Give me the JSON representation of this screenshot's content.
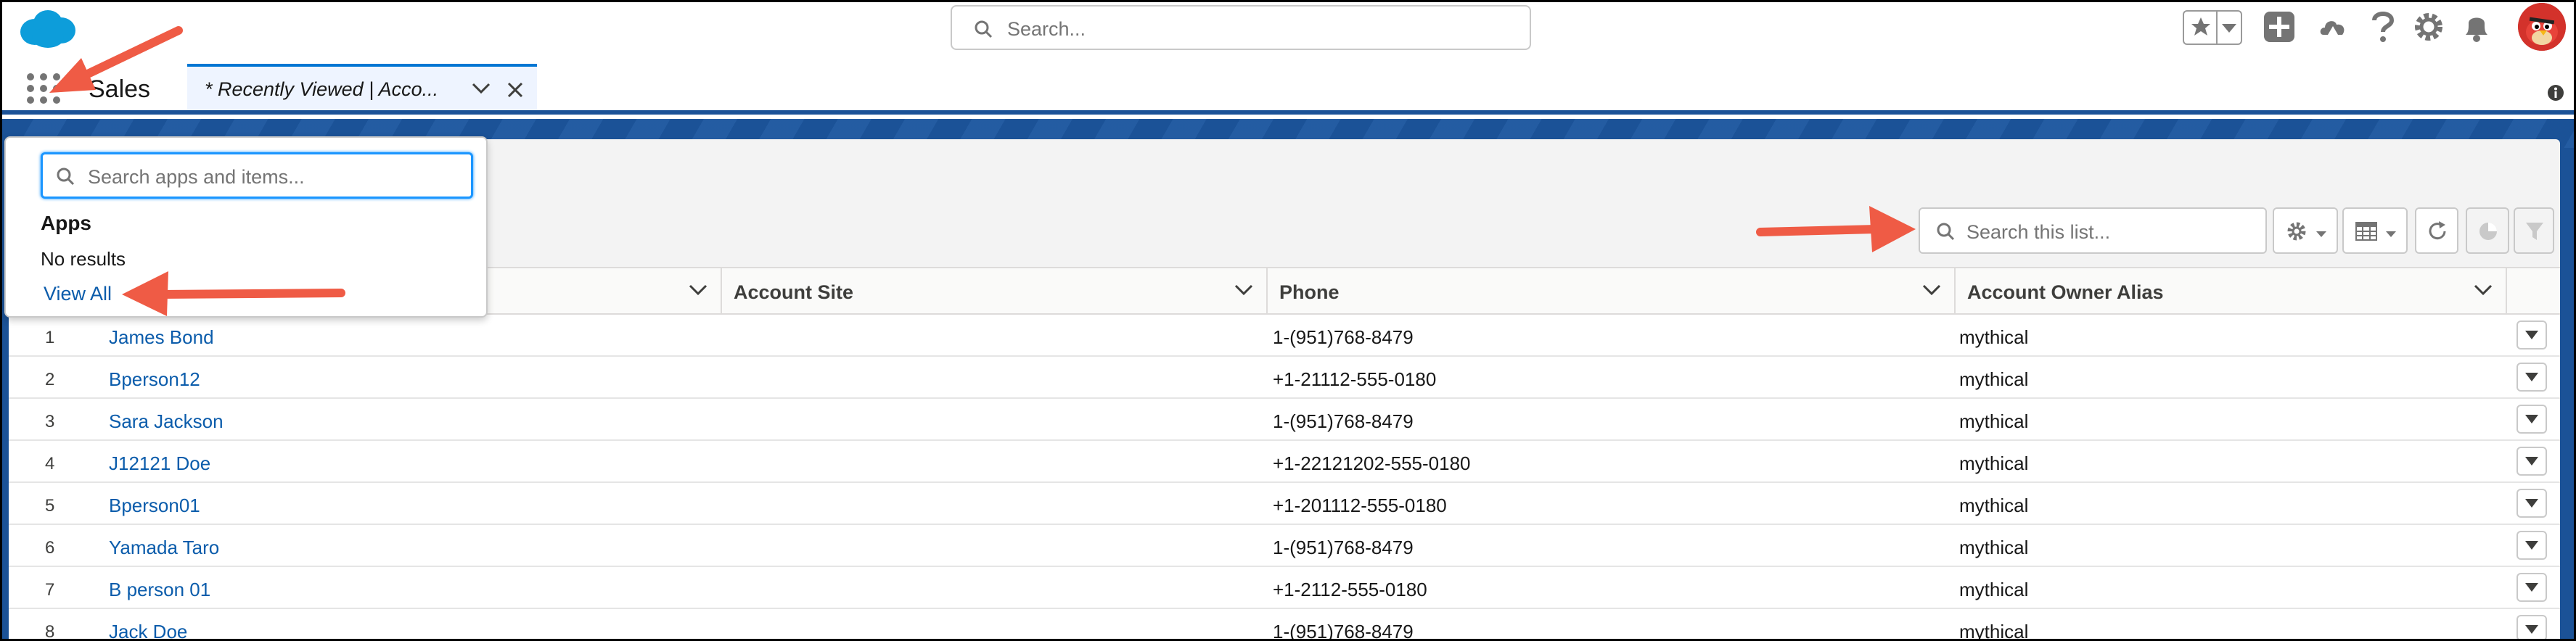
{
  "header": {
    "search_placeholder": "Search..."
  },
  "nav": {
    "app_name": "Sales",
    "tab_label": "* Recently Viewed | Acco..."
  },
  "launcher": {
    "search_placeholder": "Search apps and items...",
    "heading": "Apps",
    "no_results": "No results",
    "view_all": "View All"
  },
  "list": {
    "search_placeholder": "Search this list..."
  },
  "table": {
    "columns": [
      "Account Site",
      "Phone",
      "Account Owner Alias"
    ],
    "rows": [
      {
        "num": "1",
        "name": "James Bond",
        "phone": "1-(951)768-8479",
        "owner": "mythical"
      },
      {
        "num": "2",
        "name": "Bperson12",
        "phone": "+1-21112-555-0180",
        "owner": "mythical"
      },
      {
        "num": "3",
        "name": "Sara Jackson",
        "phone": "1-(951)768-8479",
        "owner": "mythical"
      },
      {
        "num": "4",
        "name": "J12121 Doe",
        "phone": "+1-22121202-555-0180",
        "owner": "mythical"
      },
      {
        "num": "5",
        "name": "Bperson01",
        "phone": "+1-201112-555-0180",
        "owner": "mythical"
      },
      {
        "num": "6",
        "name": "Yamada Taro",
        "phone": "1-(951)768-8479",
        "owner": "mythical"
      },
      {
        "num": "7",
        "name": "B person 01",
        "phone": "+1-2112-555-0180",
        "owner": "mythical"
      },
      {
        "num": "8",
        "name": "Jack Doe",
        "phone": "1-(951)768-8479",
        "owner": "mythical"
      }
    ]
  },
  "colors": {
    "brand_blue": "#1b5297",
    "link": "#0b5cab",
    "focus": "#1b96ff",
    "arrow": "#ef5b45"
  }
}
